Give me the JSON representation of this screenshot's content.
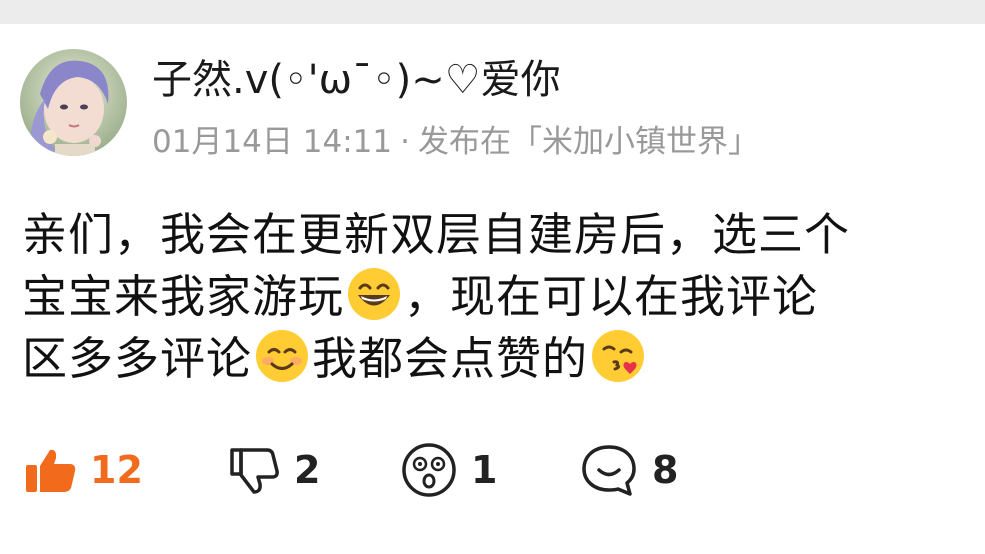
{
  "user": {
    "name": "子然.v(◦'ωˉ◦)~♡爱你",
    "avatar_icon": "avatar-image"
  },
  "meta": {
    "date": "01月14日 14:11",
    "separator": "·",
    "published_in": "发布在「米加小镇世界」"
  },
  "post": {
    "line1": "亲们，我会在更新双层自建房后，选三个",
    "line2a": "宝宝来我家游玩",
    "line2b": "，现在可以在我评论",
    "line3a": "区多多评论",
    "line3b": "我都会点赞的",
    "emojis": [
      "grinning-face-emoji",
      "smiling-face-emoji",
      "kissing-heart-emoji"
    ]
  },
  "actions": {
    "like": {
      "icon": "thumbs-up-icon",
      "count": "12",
      "color": "#f26b1d"
    },
    "dislike": {
      "icon": "thumbs-down-icon",
      "count": "2"
    },
    "surprise": {
      "icon": "dizzy-face-icon",
      "count": "1"
    },
    "comment": {
      "icon": "comment-bubble-icon",
      "count": "8"
    }
  },
  "colors": {
    "accent": "#f26b1d",
    "meta_text": "#999999",
    "top_bar": "#ececec"
  }
}
